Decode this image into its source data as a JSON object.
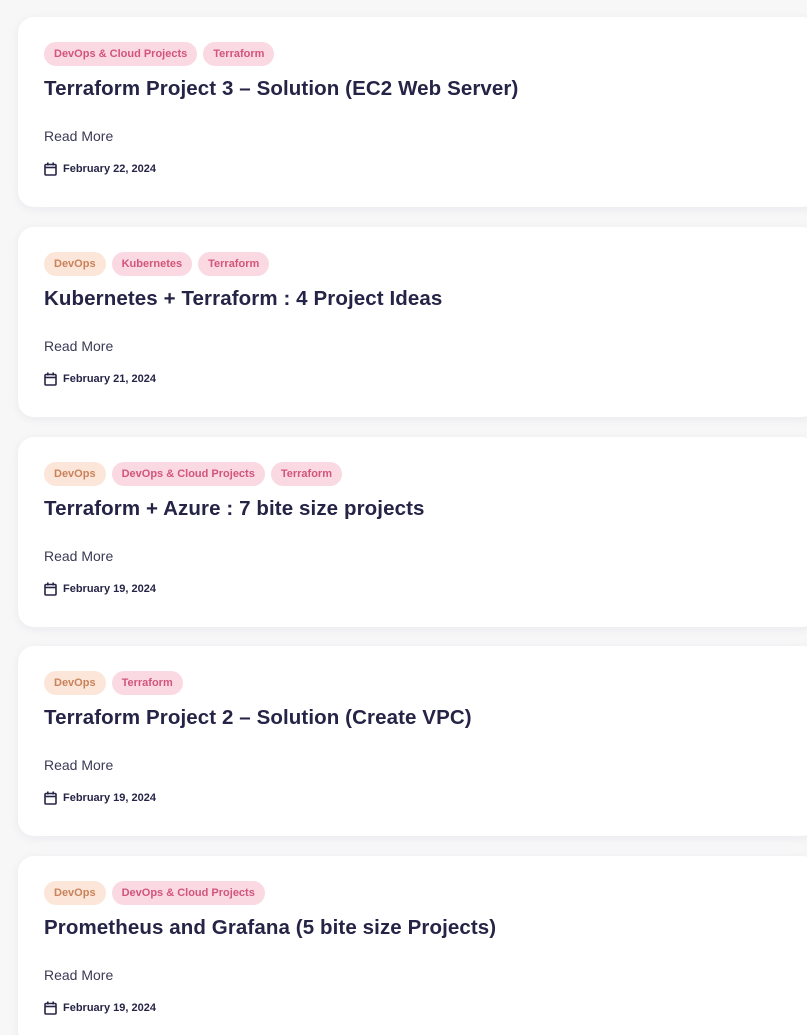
{
  "posts": [
    {
      "tags": [
        {
          "label": "DevOps & Cloud Projects",
          "style": "pink"
        },
        {
          "label": "Terraform",
          "style": "pink"
        }
      ],
      "title": "Terraform Project 3 – Solution (EC2 Web Server)",
      "read_more": "Read More",
      "date": "February 22, 2024"
    },
    {
      "tags": [
        {
          "label": "DevOps",
          "style": "devops"
        },
        {
          "label": "Kubernetes",
          "style": "pink"
        },
        {
          "label": "Terraform",
          "style": "pink"
        }
      ],
      "title": "Kubernetes + Terraform : 4 Project Ideas",
      "read_more": "Read More",
      "date": "February 21, 2024"
    },
    {
      "tags": [
        {
          "label": "DevOps",
          "style": "devops"
        },
        {
          "label": "DevOps & Cloud Projects",
          "style": "pink"
        },
        {
          "label": "Terraform",
          "style": "pink"
        }
      ],
      "title": "Terraform + Azure : 7 bite size projects",
      "read_more": "Read More",
      "date": "February 19, 2024"
    },
    {
      "tags": [
        {
          "label": "DevOps",
          "style": "devops"
        },
        {
          "label": "Terraform",
          "style": "pink"
        }
      ],
      "title": "Terraform Project 2 – Solution (Create VPC)",
      "read_more": "Read More",
      "date": "February 19, 2024"
    },
    {
      "tags": [
        {
          "label": "DevOps",
          "style": "devops"
        },
        {
          "label": "DevOps & Cloud Projects",
          "style": "pink"
        }
      ],
      "title": "Prometheus and Grafana (5 bite size Projects)",
      "read_more": "Read More",
      "date": "February 19, 2024"
    }
  ],
  "colors": {
    "title": "#262446",
    "devops_tag_bg": "#fbe6d9",
    "devops_tag_text": "#c9825a",
    "pink_tag_bg": "#fbd9e2",
    "pink_tag_text": "#d2557a"
  },
  "icons": {
    "date": "calendar-icon"
  }
}
